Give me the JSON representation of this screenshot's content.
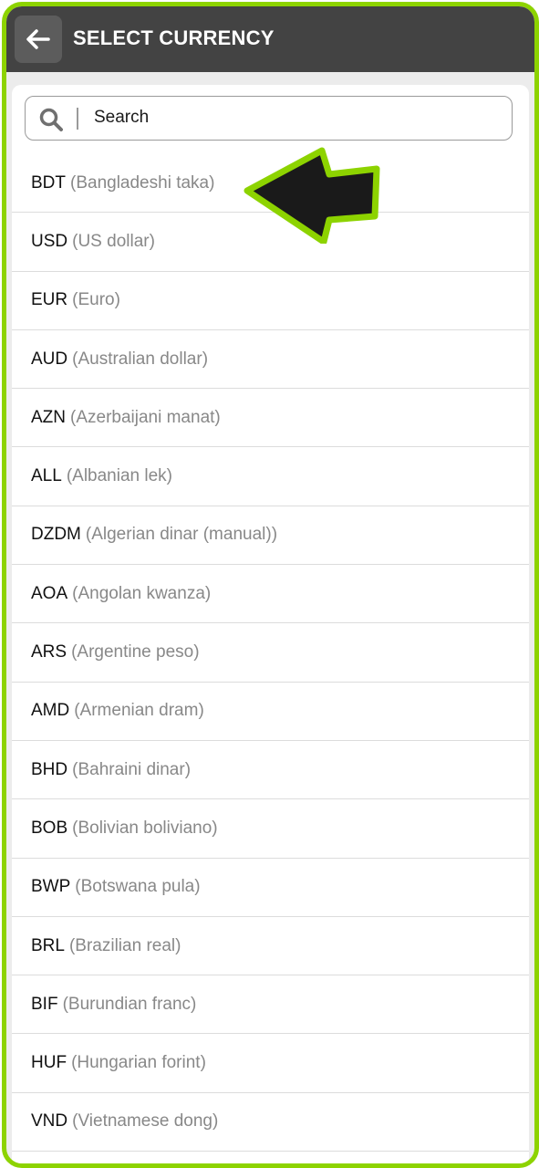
{
  "header": {
    "title": "SELECT CURRENCY",
    "back_icon": "arrow-left-icon"
  },
  "search": {
    "placeholder": "Search",
    "value": "",
    "icon": "search-icon"
  },
  "currencies": [
    {
      "code": "BDT",
      "name": "(Bangladeshi taka)"
    },
    {
      "code": "USD",
      "name": "(US dollar)"
    },
    {
      "code": "EUR",
      "name": "(Euro)"
    },
    {
      "code": "AUD",
      "name": "(Australian dollar)"
    },
    {
      "code": "AZN",
      "name": "(Azerbaijani manat)"
    },
    {
      "code": "ALL",
      "name": "(Albanian lek)"
    },
    {
      "code": "DZDM",
      "name": "(Algerian dinar (manual))"
    },
    {
      "code": "AOA",
      "name": "(Angolan kwanza)"
    },
    {
      "code": "ARS",
      "name": "(Argentine peso)"
    },
    {
      "code": "AMD",
      "name": "(Armenian dram)"
    },
    {
      "code": "BHD",
      "name": "(Bahraini dinar)"
    },
    {
      "code": "BOB",
      "name": "(Bolivian boliviano)"
    },
    {
      "code": "BWP",
      "name": "(Botswana pula)"
    },
    {
      "code": "BRL",
      "name": "(Brazilian real)"
    },
    {
      "code": "BIF",
      "name": "(Burundian franc)"
    },
    {
      "code": "HUF",
      "name": "(Hungarian forint)"
    },
    {
      "code": "VND",
      "name": "(Vietnamese dong)"
    }
  ],
  "colors": {
    "frame_border": "#8dd300",
    "header_bg": "#434343",
    "annotation_arrow_fill": "#1a1a1a",
    "annotation_arrow_outline": "#8dd300"
  }
}
